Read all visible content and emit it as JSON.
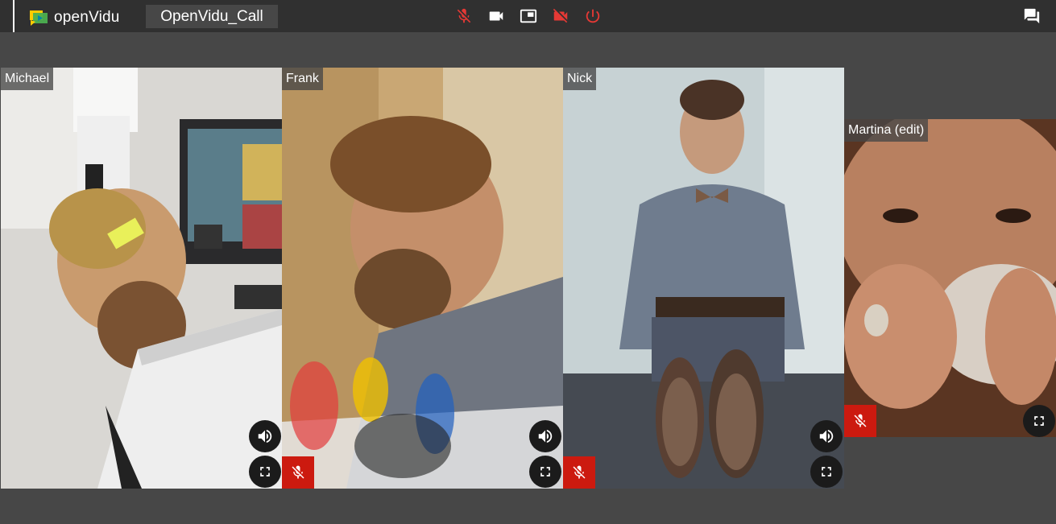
{
  "app": {
    "logo_text": "openVidu",
    "session_name": "OpenVidu_Call"
  },
  "toolbar": {
    "buttons": [
      {
        "name": "mic-off-button",
        "icon": "mic-off-icon",
        "color": "#e53935"
      },
      {
        "name": "camera-button",
        "icon": "videocam-icon",
        "color": "#ffffff"
      },
      {
        "name": "screen-share-button",
        "icon": "picture-in-picture-icon",
        "color": "#ffffff"
      },
      {
        "name": "camera-off-button",
        "icon": "videocam-off-icon",
        "color": "#e53935"
      },
      {
        "name": "leave-session-button",
        "icon": "power-icon",
        "color": "#e53935"
      },
      {
        "name": "chat-button",
        "icon": "forum-icon",
        "color": "#ffffff"
      }
    ]
  },
  "participants": [
    {
      "name": "Michael",
      "muted": false,
      "controls": [
        "volume-icon",
        "fullscreen-icon"
      ]
    },
    {
      "name": "Frank",
      "muted": true,
      "controls": [
        "volume-icon",
        "fullscreen-icon"
      ]
    },
    {
      "name": "Nick",
      "muted": true,
      "controls": [
        "volume-icon",
        "fullscreen-icon"
      ]
    },
    {
      "name": "Martina (edit)",
      "muted": true,
      "controls": [
        "fullscreen-icon"
      ]
    }
  ],
  "colors": {
    "toolbar_bg": "#303030",
    "page_bg": "#474747",
    "muted_red": "#cc1a0f",
    "accent_red": "#e53935"
  }
}
